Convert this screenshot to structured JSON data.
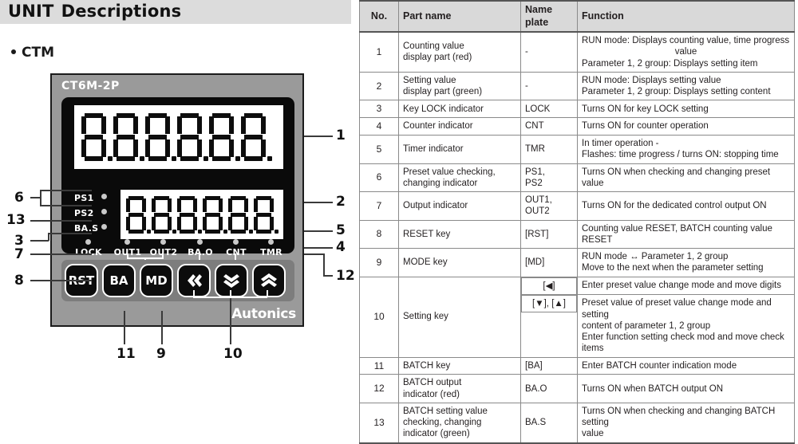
{
  "header": {
    "title_word1": "UNIT",
    "title_word2": "Descriptions"
  },
  "section": {
    "bullet_label": "CTM"
  },
  "device": {
    "model": "CT6M-2P",
    "brand": "Autonics",
    "display_top_value": "8.8.8.8.8.8",
    "display_bottom_value": "8.8.8.8.8.8",
    "display_top_digits": 6,
    "display_bottom_digits": 6,
    "side_indicators": [
      "PS1",
      "PS2",
      "BA.S"
    ],
    "status_leds": [
      "LOCK",
      "OUT1",
      "OUT2",
      "BA.O",
      "CNT",
      "TMR"
    ],
    "keys": [
      {
        "label": "RST",
        "icon": "text"
      },
      {
        "label": "BA",
        "icon": "text"
      },
      {
        "label": "MD",
        "icon": "text"
      },
      {
        "label": "",
        "icon": "double-chevron-left-icon"
      },
      {
        "label": "",
        "icon": "double-chevron-down-icon"
      },
      {
        "label": "",
        "icon": "double-chevron-up-icon"
      }
    ],
    "callouts": {
      "left": [
        "6",
        "13",
        "3",
        "7",
        "8"
      ],
      "right": [
        "1",
        "2",
        "5",
        "4",
        "12"
      ],
      "bottom": [
        "11",
        "9",
        "10"
      ]
    }
  },
  "table": {
    "columns": [
      "No.",
      "Part name",
      "Name plate",
      "Function"
    ],
    "rows": [
      {
        "no": "1",
        "part": "Counting value\ndisplay part (red)",
        "plate": "-",
        "function_lines": [
          "RUN mode: Displays counting value, time progress",
          "value",
          "Parameter 1, 2 group: Displays setting item"
        ],
        "function_center_line": 1
      },
      {
        "no": "2",
        "part": "Setting value\ndisplay part (green)",
        "plate": "-",
        "function_lines": [
          "RUN mode: Displays setting value",
          "Parameter 1, 2 group: Displays setting content"
        ]
      },
      {
        "no": "3",
        "part": "Key LOCK indicator",
        "plate": "LOCK",
        "function_lines": [
          "Turns ON for key LOCK setting"
        ]
      },
      {
        "no": "4",
        "part": "Counter indicator",
        "plate": "CNT",
        "function_lines": [
          "Turns ON for counter operation"
        ]
      },
      {
        "no": "5",
        "part": "Timer indicator",
        "plate": "TMR",
        "function_lines": [
          "In timer operation -",
          "Flashes: time progress / turns ON: stopping time"
        ]
      },
      {
        "no": "6",
        "part": "Preset value checking,\nchanging indicator",
        "plate": "PS1,\nPS2",
        "function_lines": [
          "Turns ON when checking and changing preset value"
        ]
      },
      {
        "no": "7",
        "part": "Output indicator",
        "plate": "OUT1,\nOUT2",
        "function_lines": [
          "Turns ON for the dedicated control output ON"
        ]
      },
      {
        "no": "8",
        "part": "RESET key",
        "plate": "[RST]",
        "function_lines": [
          "Counting value RESET, BATCH counting value RESET"
        ]
      },
      {
        "no": "9",
        "part": "MODE key",
        "plate": "[MD]",
        "function_lines": [
          "RUN mode ↔ Parameter 1, 2 group",
          "Move to the next when the parameter setting"
        ]
      },
      {
        "no": "10",
        "part": "Setting key",
        "sub": [
          {
            "plate": "[◀]",
            "function_lines": [
              "Enter preset value change mode and move digits"
            ]
          },
          {
            "plate": "[▼], [▲]",
            "function_lines": [
              "Preset value of preset value change mode and setting",
              "content of parameter 1, 2 group",
              "Enter function setting check mod and move check items"
            ]
          }
        ]
      },
      {
        "no": "11",
        "part": "BATCH key",
        "plate": "[BA]",
        "function_lines": [
          "Enter BATCH counter indication mode"
        ]
      },
      {
        "no": "12",
        "part": "BATCH output\nindicator (red)",
        "plate": "BA.O",
        "function_lines": [
          "Turns ON when BATCH output ON"
        ]
      },
      {
        "no": "13",
        "part": "BATCH setting value\nchecking, changing\nindicator (green)",
        "plate": "BA.S",
        "function_lines": [
          "Turns ON when checking and changing BATCH setting",
          "value"
        ]
      }
    ]
  },
  "colors": {
    "title_band": "#dcdcdc",
    "header_row": "#d9d9d9",
    "bezel": "#9a9a9a",
    "panel": "#0a0a0a",
    "keypad": "#7d7d7d",
    "led": "#c9c9c9",
    "text": "#231f20"
  }
}
